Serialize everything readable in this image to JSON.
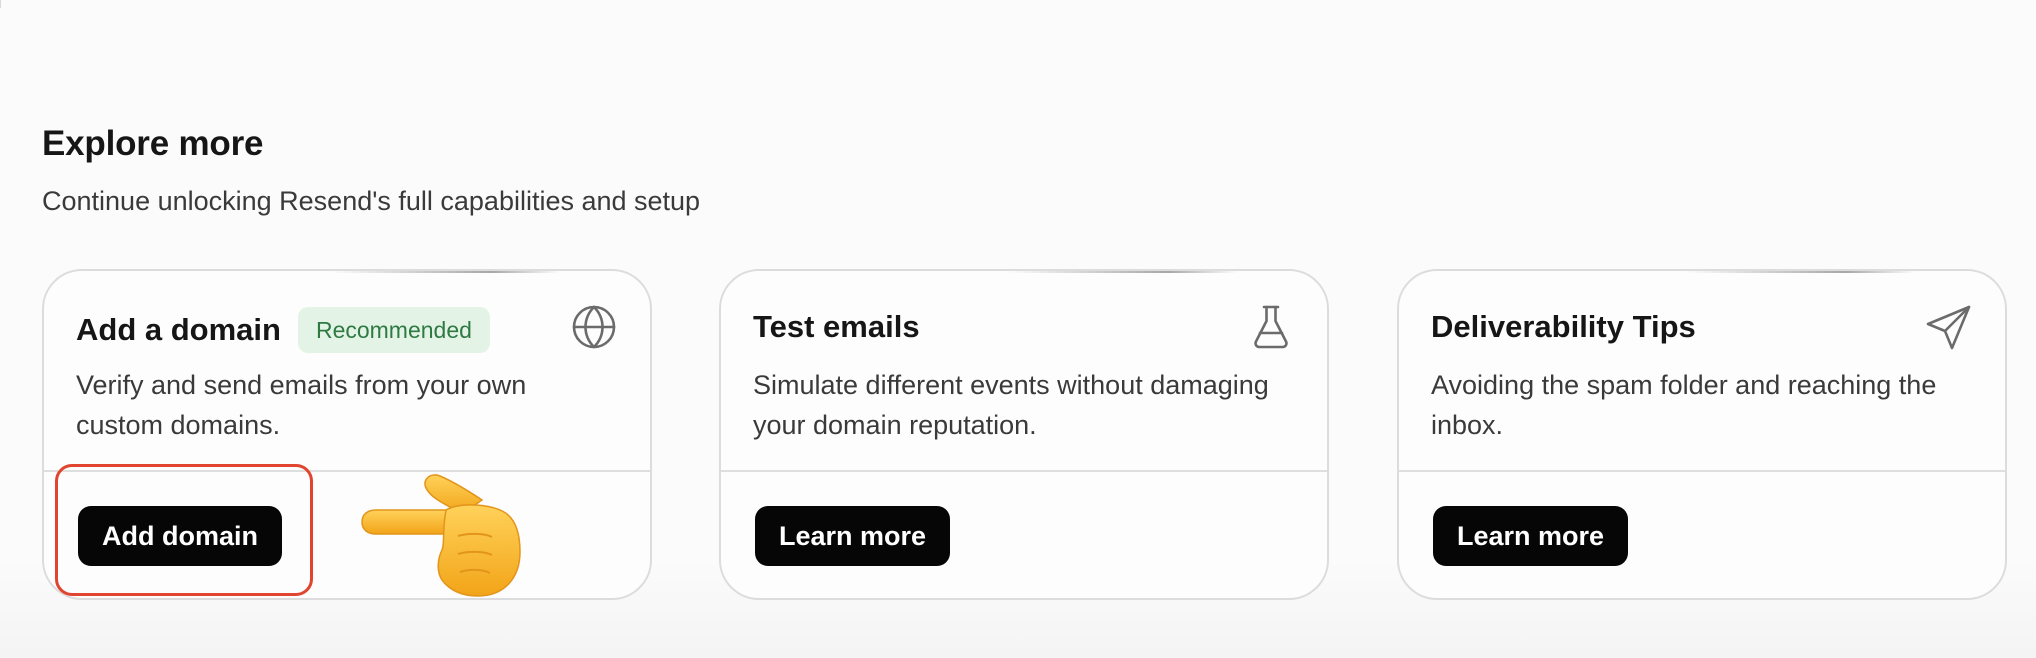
{
  "section": {
    "title": "Explore more",
    "subtitle": "Continue unlocking Resend's full capabilities and setup"
  },
  "cards": [
    {
      "title": "Add a domain",
      "badge": "Recommended",
      "description": "Verify and send emails from your own custom domains.",
      "icon": "globe-icon",
      "button_label": "Add domain"
    },
    {
      "title": "Test emails",
      "description": "Simulate different events without damaging your domain reputation.",
      "icon": "flask-icon",
      "button_label": "Learn more"
    },
    {
      "title": "Deliverability Tips",
      "description": "Avoiding the spam folder and reaching the inbox.",
      "icon": "send-icon",
      "button_label": "Learn more"
    }
  ],
  "annotations": {
    "highlight_color": "#e2452f",
    "pointer": "pointing-hand-emoji"
  },
  "colors": {
    "button_bg": "#060606",
    "badge_bg": "#e3f4e6",
    "badge_text": "#2f7a43"
  }
}
